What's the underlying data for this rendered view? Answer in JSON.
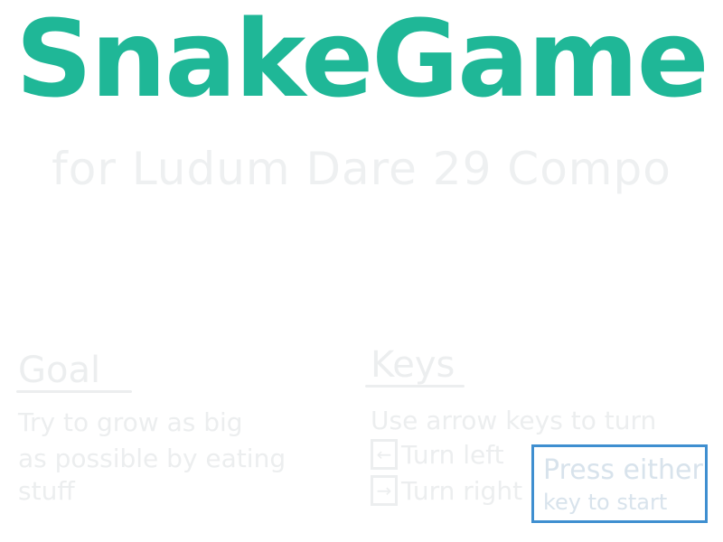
{
  "title": "SnakeGame",
  "subtitle": "for Ludum Dare 29 Compo",
  "goal": {
    "heading": "Goal",
    "lines": [
      "Try to grow as big",
      "as possible by eating",
      "stuff"
    ]
  },
  "keys": {
    "heading": "Keys",
    "instruction": "Use arrow keys to turn",
    "left": {
      "icon": "left-arrow-key-icon",
      "glyph": "←",
      "label": "Turn left"
    },
    "right": {
      "icon": "right-arrow-key-icon",
      "glyph": "→",
      "label": "Turn right"
    }
  },
  "start_prompt": {
    "line1": "Press either",
    "line2": "key to start"
  },
  "colors": {
    "title": "#1fb797",
    "faded_text": "#eceeef",
    "start_box_border": "#3f8fd0",
    "background": "#ffffff"
  }
}
